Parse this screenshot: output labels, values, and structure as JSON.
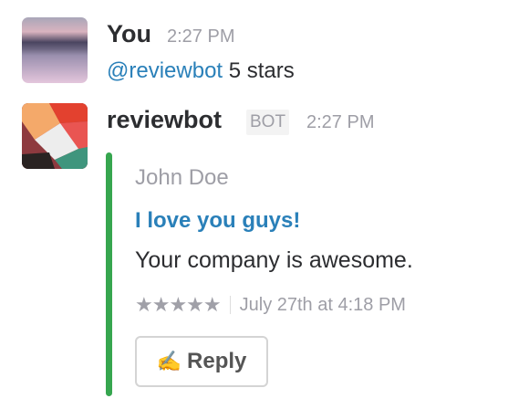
{
  "messages": [
    {
      "author": "You",
      "time": "2:27 PM",
      "mention": "@reviewbot",
      "text": "5 stars"
    },
    {
      "author": "reviewbot",
      "badge": "BOT",
      "time": "2:27 PM",
      "attachment": {
        "color": "#36a64f",
        "author_name": "John Doe",
        "title": "I love you guys!",
        "text": "Your company is awesome.",
        "stars": "★★★★★",
        "rating": 5,
        "footer_time": "July 27th at 4:18 PM",
        "button": {
          "icon": "writing-hand-icon",
          "emoji": "✍️",
          "label": "Reply"
        }
      }
    }
  ]
}
